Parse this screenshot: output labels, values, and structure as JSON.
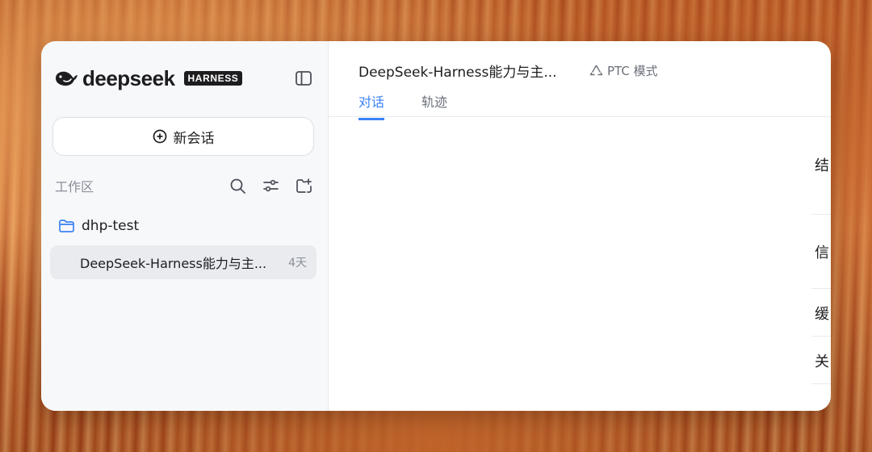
{
  "sidebar": {
    "logo_text": "deepseek",
    "logo_badge": "HARNESS",
    "new_chat_label": "新会话",
    "workspace_title": "工作区",
    "folder_name": "dhp-test",
    "session": {
      "title": "DeepSeek-Harness能力与主...",
      "time": "4天"
    }
  },
  "main": {
    "title": "DeepSeek-Harness能力与主...",
    "mode_label": "PTC 模式",
    "tabs": [
      {
        "label": "对话"
      },
      {
        "label": "轨迹"
      }
    ],
    "clipped_chars": [
      "结",
      "信",
      "缓",
      "关"
    ]
  },
  "colors": {
    "accent": "#3b82f6",
    "folder_icon": "#3b82f6",
    "logo": "#1d1d1f"
  },
  "icons": [
    "whale-logo-icon",
    "sidebar-toggle-icon",
    "plus-circle-icon",
    "search-icon",
    "filter-sliders-icon",
    "new-folder-icon",
    "folder-icon",
    "recycle-icon"
  ]
}
